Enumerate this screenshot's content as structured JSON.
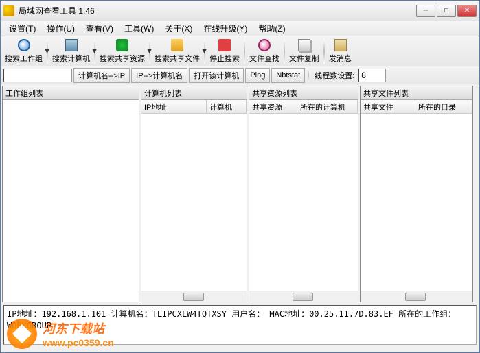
{
  "title": "局域网查看工具 1.46",
  "menu": [
    {
      "label": "设置(T)"
    },
    {
      "label": "操作(U)"
    },
    {
      "label": "查看(V)"
    },
    {
      "label": "工具(W)"
    },
    {
      "label": "关于(X)"
    },
    {
      "label": "在线升级(Y)"
    },
    {
      "label": "帮助(Z)"
    }
  ],
  "toolbar1": [
    {
      "label": "搜索工作组",
      "icon": "search"
    },
    {
      "label": "搜索计算机",
      "icon": "pc"
    },
    {
      "label": "搜索共享资源",
      "icon": "share"
    },
    {
      "label": "搜索共享文件",
      "icon": "folder"
    },
    {
      "label": "停止搜索",
      "icon": "stop"
    },
    {
      "label": "文件查找",
      "icon": "find"
    },
    {
      "label": "文件复制",
      "icon": "copy"
    },
    {
      "label": "发消息",
      "icon": "msg"
    }
  ],
  "toolbar2": {
    "inputValue": "",
    "btn1": "计算机名-->IP",
    "btn2": "IP-->计算机名",
    "btn3": "打开该计算机",
    "btn4": "Ping",
    "btn5": "Nbtstat",
    "threadLabel": "线程数设置:",
    "threadValue": "8"
  },
  "panels": {
    "p1": {
      "title": "工作组列表"
    },
    "p2": {
      "title": "计算机列表",
      "col1": "IP地址",
      "col2": "计算机"
    },
    "p3": {
      "title": "共享资源列表",
      "col1": "共享资源",
      "col2": "所在的计算机"
    },
    "p4": {
      "title": "共享文件列表",
      "col1": "共享文件",
      "col2": "所在的目录"
    }
  },
  "statusText": "IP地址：192.168.1.101 计算机名：TLIPCXLW4TQTXSY 用户名： MAC地址：00.25.11.7D.83.EF 所在的工作组：WORKGROUP",
  "watermark": {
    "site": "河东下载站",
    "url": "www.pc0359.cn"
  }
}
